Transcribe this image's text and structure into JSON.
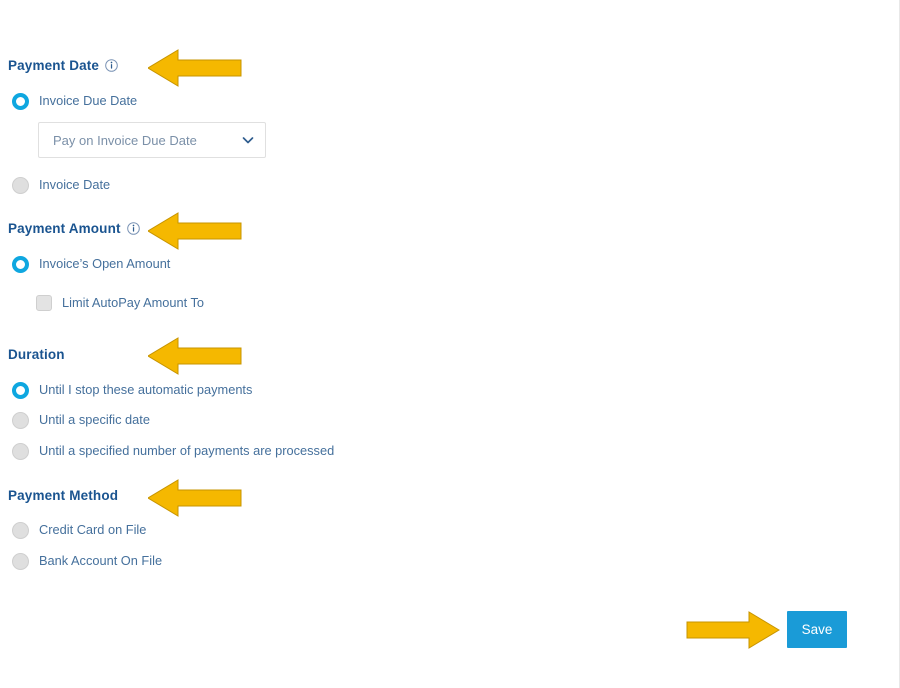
{
  "form": {
    "sections": [
      {
        "key": "payment_date",
        "heading": "Payment Date",
        "has_info_icon": true,
        "options": [
          {
            "label": "Invoice Due Date",
            "selected": true
          },
          {
            "label": "Invoice Date",
            "selected": false
          }
        ],
        "select": {
          "value": "Pay on Invoice Due Date",
          "options": [
            "Pay on Invoice Due Date"
          ]
        }
      },
      {
        "key": "payment_amount",
        "heading": "Payment Amount",
        "has_info_icon": true,
        "options": [
          {
            "label": "Invoice’s Open Amount",
            "selected": true
          }
        ],
        "checkbox": {
          "label": "Limit AutoPay Amount To",
          "checked": false
        }
      },
      {
        "key": "duration",
        "heading": "Duration",
        "has_info_icon": false,
        "options": [
          {
            "label": "Until I stop these automatic payments",
            "selected": true
          },
          {
            "label": "Until a specific date",
            "selected": false
          },
          {
            "label": "Until a specified number of payments are processed",
            "selected": false
          }
        ]
      },
      {
        "key": "payment_method",
        "heading": "Payment Method",
        "has_info_icon": false,
        "options": [
          {
            "label": "Credit Card on File",
            "selected": false
          },
          {
            "label": "Bank Account On File",
            "selected": false
          }
        ]
      }
    ],
    "save_label": "Save"
  },
  "annotations": {
    "arrow_color": "#f5b800",
    "arrow_border": "#c79400",
    "arrows": [
      {
        "name": "arrow-payment-date",
        "direction": "left"
      },
      {
        "name": "arrow-payment-amount",
        "direction": "left"
      },
      {
        "name": "arrow-duration",
        "direction": "left"
      },
      {
        "name": "arrow-payment-method",
        "direction": "left"
      },
      {
        "name": "arrow-save",
        "direction": "right"
      }
    ]
  },
  "colors": {
    "heading": "#1a5490",
    "label": "#45709c",
    "accent": "#0fa7e0",
    "save_button": "#1a9bd7",
    "background": "#ffffff"
  }
}
